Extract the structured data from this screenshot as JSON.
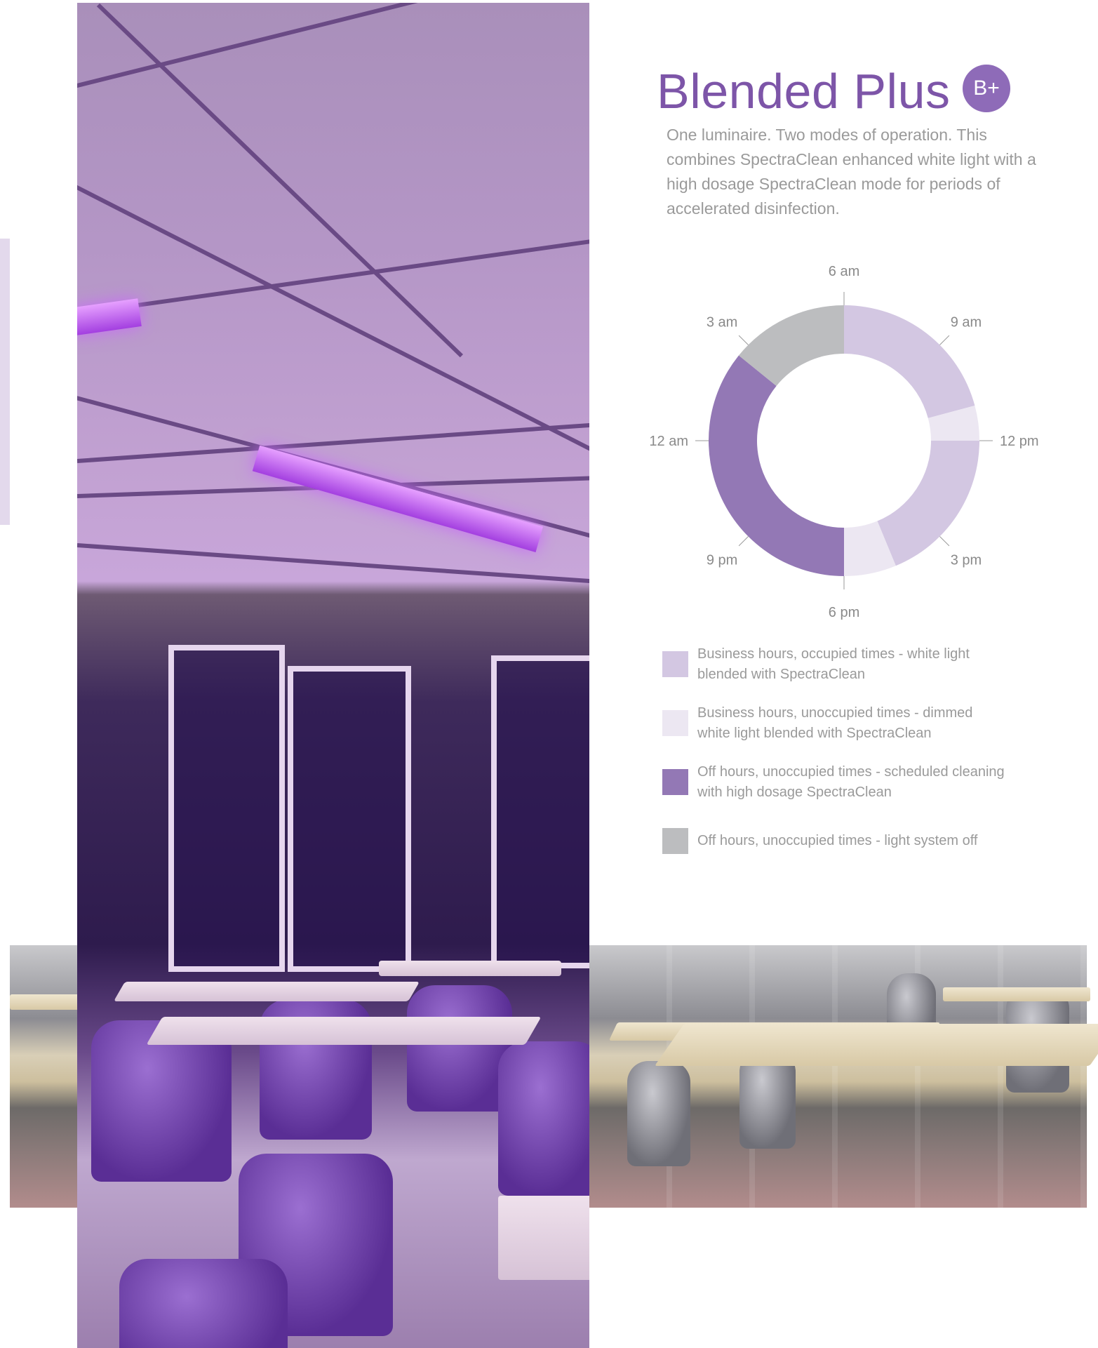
{
  "page": {
    "title": "Blended Plus",
    "badge": "B+",
    "intro": "One luminaire. Two modes of operation. This combines SpectraClean enhanced white light with a high dosage SpectraClean mode for periods of accelerated disinfection."
  },
  "colors": {
    "title": "#7d55a8",
    "badge": "#8e6bb8",
    "body_text": "#9a9a9a",
    "business_occupied": "#d3c7e2",
    "business_unoccupied": "#ece7f2",
    "off_hours_cleaning": "#9378b5",
    "off_hours_off": "#bcbdbf"
  },
  "images": [
    {
      "name": "classroom-photo-purple",
      "description_icon": "photo-icon"
    },
    {
      "name": "classroom-photo-strip",
      "description_icon": "photo-icon"
    }
  ],
  "legend": [
    {
      "key": "business_occupied",
      "label": "Business hours, occupied times - white light blended with SpectraClean"
    },
    {
      "key": "business_unoccupied",
      "label": "Business hours, unoccupied times - dimmed white light blended with SpectraClean"
    },
    {
      "key": "off_hours_cleaning",
      "label": "Off hours, unoccupied times - scheduled cleaning with high dosage SpectraClean"
    },
    {
      "key": "off_hours_off",
      "label": "Off hours, unoccupied times - light system off"
    }
  ],
  "chart_data": {
    "type": "pie",
    "variant": "donut",
    "unit": "hours of day",
    "clock_labels": [
      {
        "hour": 6,
        "label": "6 am"
      },
      {
        "hour": 9,
        "label": "9 am"
      },
      {
        "hour": 12,
        "label": "12 pm"
      },
      {
        "hour": 15,
        "label": "3 pm"
      },
      {
        "hour": 18,
        "label": "6 pm"
      },
      {
        "hour": 21,
        "label": "9 pm"
      },
      {
        "hour": 0,
        "label": "12 am"
      },
      {
        "hour": 3,
        "label": "3 am"
      }
    ],
    "segments": [
      {
        "from": 6,
        "to": 11,
        "key": "business_occupied"
      },
      {
        "from": 11,
        "to": 12,
        "key": "business_unoccupied"
      },
      {
        "from": 12,
        "to": 16.5,
        "key": "business_occupied"
      },
      {
        "from": 16.5,
        "to": 18,
        "key": "business_unoccupied"
      },
      {
        "from": 18,
        "to": 2.6,
        "key": "off_hours_cleaning"
      },
      {
        "from": 2.6,
        "to": 6,
        "key": "off_hours_off"
      }
    ]
  }
}
